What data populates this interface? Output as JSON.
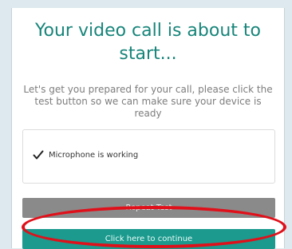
{
  "dialog": {
    "title": "Your video call is about to start...",
    "subtitle": "Let's get you prepared for your call, please click the test button so we can make sure your device is ready"
  },
  "status": {
    "icon": "check-icon",
    "text": "Microphone is working"
  },
  "buttons": {
    "repeat_label": "Repeat Test",
    "continue_label": "Click here to continue"
  },
  "colors": {
    "title": "#17857a",
    "continue_button": "#1b9a8d",
    "repeat_button": "#8a8a8a",
    "highlight": "#e0101a",
    "page_background": "#dde9ee"
  }
}
